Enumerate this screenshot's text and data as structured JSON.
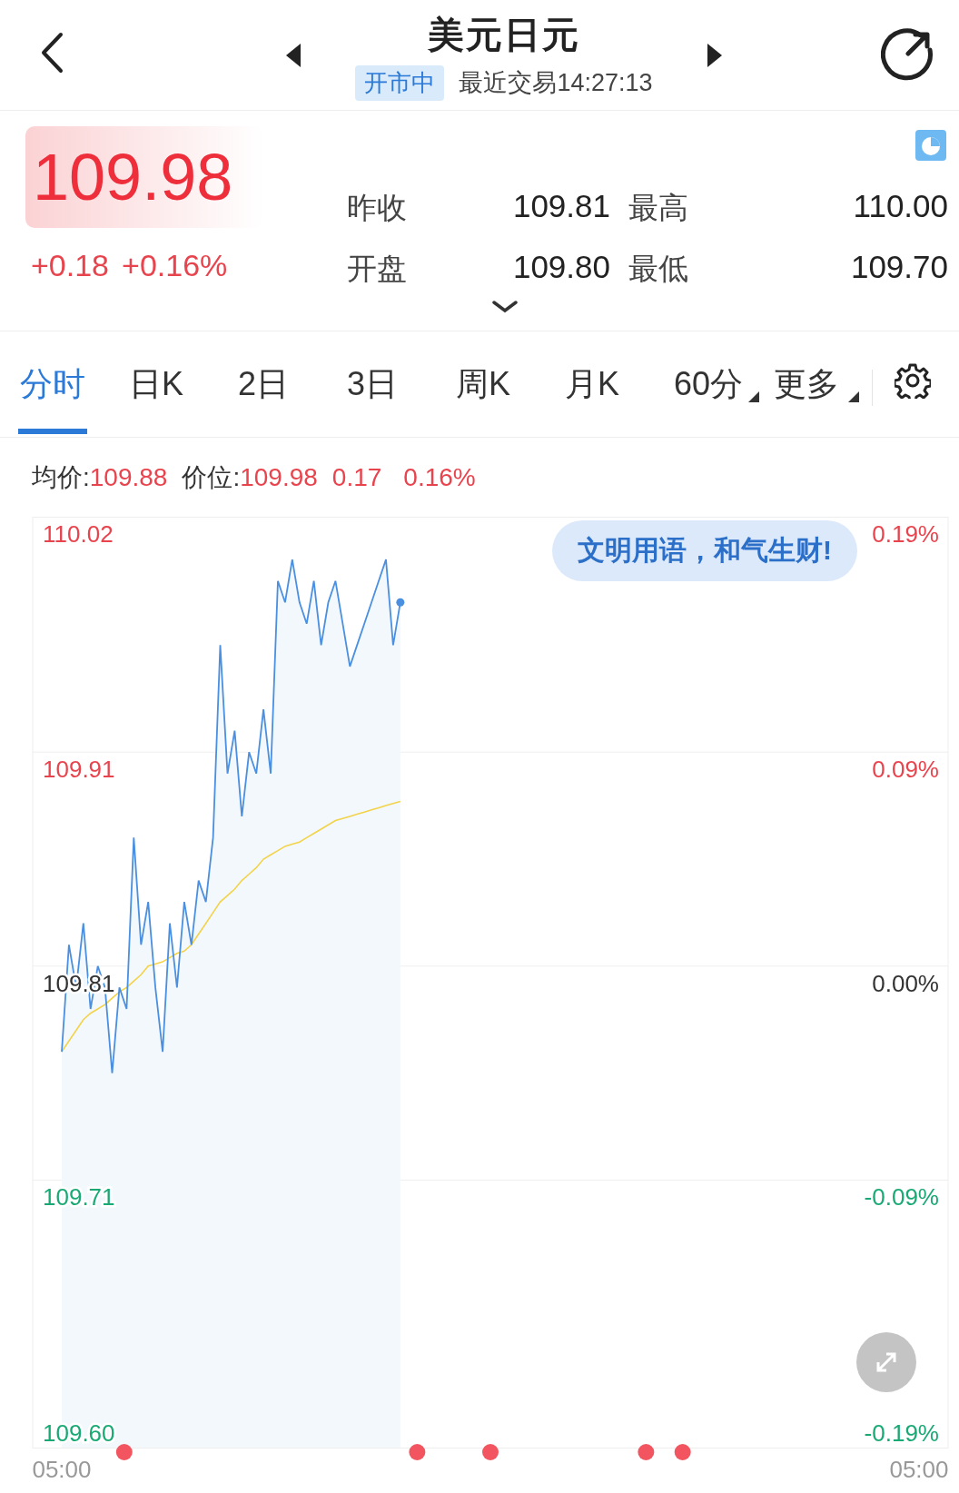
{
  "header": {
    "title": "美元日元",
    "status_badge": "开市中",
    "last_trade": "最近交易14:27:13"
  },
  "quote": {
    "price": "109.98",
    "change": "+0.18",
    "change_percent": "+0.16%",
    "stats": [
      {
        "label": "昨收",
        "value": "109.81"
      },
      {
        "label": "最高",
        "value": "110.00"
      },
      {
        "label": "开盘",
        "value": "109.80"
      },
      {
        "label": "最低",
        "value": "109.70"
      }
    ]
  },
  "tabs": [
    {
      "label": "分时",
      "selected": true,
      "kind": "plain"
    },
    {
      "label": "日K",
      "selected": false,
      "kind": "plain"
    },
    {
      "label": "2日",
      "selected": false,
      "kind": "plain"
    },
    {
      "label": "3日",
      "selected": false,
      "kind": "plain"
    },
    {
      "label": "周K",
      "selected": false,
      "kind": "plain"
    },
    {
      "label": "月K",
      "selected": false,
      "kind": "plain"
    },
    {
      "label": "60分",
      "selected": false,
      "kind": "dropdown"
    },
    {
      "label": "更多",
      "selected": false,
      "kind": "dropdown"
    }
  ],
  "info_line": {
    "items": [
      {
        "label": "均价:",
        "value": "109.88"
      },
      {
        "label": "价位:",
        "value": "109.98"
      }
    ],
    "change": "0.17",
    "change_percent": "0.16%"
  },
  "chart": {
    "toast": "文明用语，和气生财!",
    "right_axis_labels": [
      "0.19%",
      "0.09%",
      "0.00%",
      "-0.09%",
      "-0.19%"
    ],
    "chart_data": {
      "type": "line",
      "grid": true,
      "ylim": [
        109.585,
        110.02
      ],
      "categories": [
        "05:00",
        null,
        null,
        null,
        null,
        null,
        null,
        null,
        null,
        null,
        null,
        null,
        null,
        null,
        null,
        null,
        null,
        null,
        null,
        null,
        null,
        null,
        null,
        null,
        null,
        null,
        null,
        null,
        null,
        null,
        null,
        null,
        null,
        null,
        null,
        null,
        null,
        null,
        null,
        null,
        null,
        null,
        null,
        null,
        null,
        null,
        null,
        null,
        null,
        null,
        null,
        null,
        null,
        null,
        null,
        null,
        null,
        null,
        null,
        null,
        null,
        null,
        null,
        null,
        null,
        null,
        null,
        null,
        null,
        null,
        null,
        null,
        null,
        null,
        null,
        null,
        null,
        null,
        null,
        null,
        null,
        null,
        null,
        null,
        null,
        null,
        null,
        null,
        null,
        null,
        null,
        null,
        null,
        null,
        null,
        null,
        null,
        null,
        null,
        null,
        null,
        null,
        null,
        null,
        null,
        null,
        null,
        null,
        null,
        null,
        null,
        null,
        null,
        null,
        null,
        null,
        null,
        null,
        null,
        "05:00"
      ],
      "yticks": [
        {
          "value": 110.02,
          "label": "110.02"
        },
        {
          "value": 109.91,
          "label": "109.91"
        },
        {
          "value": 109.81,
          "label": "109.81"
        },
        {
          "value": 109.71,
          "label": "109.71"
        },
        {
          "value": 109.6,
          "label": "109.60"
        }
      ],
      "series": [
        {
          "color": "#4a8fe0",
          "values": [
            109.77,
            109.82,
            109.8,
            109.83,
            109.79,
            109.81,
            109.8,
            109.76,
            109.8,
            109.79,
            109.87,
            109.82,
            109.84,
            109.8,
            109.77,
            109.83,
            109.8,
            109.84,
            109.82,
            109.85,
            109.84,
            109.87,
            109.96,
            109.9,
            109.92,
            109.88,
            109.91,
            109.9,
            109.93,
            109.9,
            109.99,
            109.98,
            110.0,
            109.98,
            109.97,
            109.99,
            109.96,
            109.98,
            109.99,
            109.97,
            109.95,
            109.96,
            109.97,
            109.98,
            109.99,
            110.0,
            109.96,
            109.98,
            null,
            null,
            null,
            null,
            null,
            null,
            null,
            null,
            null,
            null,
            null,
            null,
            null,
            null,
            null,
            null,
            null,
            null,
            null,
            null,
            null,
            null,
            null,
            null,
            null,
            null,
            null,
            null,
            null,
            null,
            null,
            null,
            null,
            null,
            null,
            null,
            null,
            null,
            null,
            null,
            null,
            null,
            null,
            null,
            null,
            null,
            null,
            null,
            null,
            null,
            null,
            null,
            null,
            null,
            null,
            null,
            null,
            null,
            null,
            null,
            null,
            null,
            null,
            null,
            null,
            null,
            null,
            null,
            null,
            null,
            null,
            null
          ]
        },
        {
          "color": "#f2d34a",
          "values": [
            109.77,
            109.775,
            109.78,
            109.785,
            109.788,
            109.79,
            109.792,
            109.795,
            109.798,
            109.8,
            109.803,
            109.806,
            109.81,
            109.811,
            109.812,
            109.814,
            109.816,
            109.817,
            109.82,
            109.825,
            109.83,
            109.835,
            109.84,
            109.843,
            109.846,
            109.85,
            109.853,
            109.856,
            109.86,
            109.862,
            109.864,
            109.866,
            109.867,
            109.868,
            109.87,
            109.872,
            109.874,
            109.876,
            109.878,
            109.879,
            109.88,
            109.881,
            109.882,
            109.883,
            109.884,
            109.885,
            109.886,
            109.887,
            null,
            null,
            null,
            null,
            null,
            null,
            null,
            null,
            null,
            null,
            null,
            null,
            null,
            null,
            null,
            null,
            null,
            null,
            null,
            null,
            null,
            null,
            null,
            null,
            null,
            null,
            null,
            null,
            null,
            null,
            null,
            null,
            null,
            null,
            null,
            null,
            null,
            null,
            null,
            null,
            null,
            null,
            null,
            null,
            null,
            null,
            null,
            null,
            null,
            null,
            null,
            null,
            null,
            null,
            null,
            null,
            null,
            null,
            null,
            null,
            null,
            null,
            null,
            null,
            null,
            null,
            null,
            null,
            null,
            null,
            null,
            null
          ]
        }
      ]
    }
  }
}
